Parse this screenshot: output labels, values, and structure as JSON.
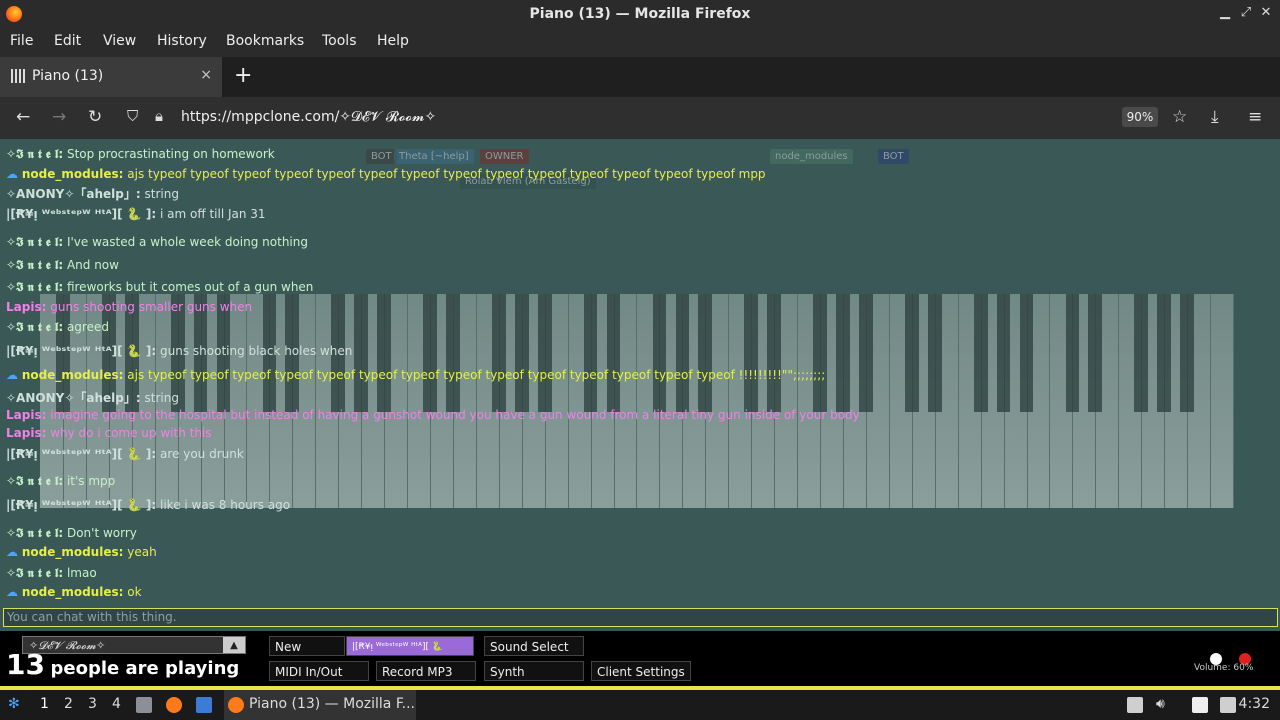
{
  "window": {
    "title": "Piano (13) — Mozilla Firefox"
  },
  "menu": [
    "File",
    "Edit",
    "View",
    "History",
    "Bookmarks",
    "Tools",
    "Help"
  ],
  "tab": {
    "title": "Piano (13)",
    "close": "×",
    "new_tab": "+"
  },
  "nav": {
    "url": "https://mppclone.com/✧𝓓𝓔𝓥 𝓡𝓸𝓸𝓶✧",
    "zoom": "90%"
  },
  "chat": [
    {
      "name": "✧𝕴 𝖓 𝖙 𝖊 𝖑:",
      "text": "Stop procrastinating on homework",
      "name_color": "#c8f0c8",
      "text_color": "#c8f0c8"
    },
    {
      "name": "node_modules:",
      "text": "ajs typeof typeof typeof typeof typeof typeof typeof typeof typeof typeof typeof typeof typeof typeof mpp",
      "name_color": "#e6ee4a",
      "text_color": "#e6ee4a"
    },
    {
      "name": "✧ANONY✧「ahelp」:",
      "text": "string",
      "name_color": "#d0e0dc",
      "text_color": "#d0e0dc"
    },
    {
      "name": "|[Ꞧ¥ᴉ ᵂᵉᵇˢᵗᵉᵖᵂ ᴴᵗᴬ][ 🐍 ]:",
      "text": "i am off till Jan 31",
      "name_color": "#d0e0dc",
      "text_color": "#d0e0dc"
    },
    {
      "name": "✧𝕴 𝖓 𝖙 𝖊 𝖑:",
      "text": "I've wasted a whole week doing nothing",
      "name_color": "#c8f0c8",
      "text_color": "#c8f0c8"
    },
    {
      "name": "✧𝕴 𝖓 𝖙 𝖊 𝖑:",
      "text": "And now",
      "name_color": "#c8f0c8",
      "text_color": "#c8f0c8"
    },
    {
      "name": "✧𝕴 𝖓 𝖙 𝖊 𝖑:",
      "text": "fireworks but it comes out of a gun when",
      "name_color": "#c8f0c8",
      "text_color": "#c8f0c8"
    },
    {
      "name": "Lapis:",
      "text": "guns shooting smaller guns when",
      "name_color": "#f080e8",
      "text_color": "#f080e8"
    },
    {
      "name": "✧𝕴 𝖓 𝖙 𝖊 𝖑:",
      "text": "agreed",
      "name_color": "#c8f0c8",
      "text_color": "#c8f0c8"
    },
    {
      "name": "|[Ꞧ¥ᴉ ᵂᵉᵇˢᵗᵉᵖᵂ ᴴᵗᴬ][ 🐍 ]:",
      "text": "guns shooting black holes when",
      "name_color": "#d0e0dc",
      "text_color": "#d0e0dc"
    },
    {
      "name": "node_modules:",
      "text": "ajs typeof typeof typeof typeof typeof typeof typeof typeof typeof typeof typeof typeof typeof typeof !!!!!!!!!\"\";;;;;;;;",
      "name_color": "#e6ee4a",
      "text_color": "#e6ee4a"
    },
    {
      "name": "✧ANONY✧「ahelp」:",
      "text": "string",
      "name_color": "#d0e0dc",
      "text_color": "#d0e0dc"
    },
    {
      "name": "Lapis:",
      "text": "imagine going to the hospital but instead of having a gunshot wound you have a gun wound from a literal tiny gun inside of your body",
      "name_color": "#f080e8",
      "text_color": "#f080e8"
    },
    {
      "name": "Lapis:",
      "text": "why do i come up with this",
      "name_color": "#f080e8",
      "text_color": "#f080e8"
    },
    {
      "name": "|[Ꞧ¥ᴉ ᵂᵉᵇˢᵗᵉᵖᵂ ᴴᵗᴬ][ 🐍 ]:",
      "text": "are you drunk",
      "name_color": "#d0e0dc",
      "text_color": "#d0e0dc"
    },
    {
      "name": "✧𝕴 𝖓 𝖙 𝖊 𝖑:",
      "text": "it's mpp",
      "name_color": "#c8f0c8",
      "text_color": "#c8f0c8"
    },
    {
      "name": "|[Ꞧ¥ᴉ ᵂᵉᵇˢᵗᵉᵖᵂ ᴴᵗᴬ][ 🐍 ]:",
      "text": "like i was 8 hours ago",
      "name_color": "#d0e0dc",
      "text_color": "#d0e0dc"
    },
    {
      "name": "✧𝕴 𝖓 𝖙 𝖊 𝖑:",
      "text": "Don't worry",
      "name_color": "#c8f0c8",
      "text_color": "#c8f0c8"
    },
    {
      "name": "node_modules:",
      "text": "yeah",
      "name_color": "#e6ee4a",
      "text_color": "#e6ee4a"
    },
    {
      "name": "✧𝕴 𝖓 𝖙 𝖊 𝖑:",
      "text": "lmao",
      "name_color": "#c8f0c8",
      "text_color": "#c8f0c8"
    },
    {
      "name": "node_modules:",
      "text": "ok",
      "name_color": "#e6ee4a",
      "text_color": "#e6ee4a"
    }
  ],
  "chat_input_placeholder": "You can chat with this thing.",
  "badges": [
    "BOT",
    "Theta [~help]",
    "OWNER",
    "node_modules",
    "BOT",
    "Rolab Vlem (Am Gastelg)"
  ],
  "room": {
    "name": "✧𝓓𝓔𝓥 𝓡𝓸𝓸𝓶✧",
    "arrow": "▲"
  },
  "players": {
    "count": "13",
    "label": "people are playing"
  },
  "buttons": {
    "new_room": "New Room...",
    "user_tag": "|[Ꞧ¥ᴉ ᵂᵉᵇˢᵗᵉᵖᵂ ᴴᵗᴬ][ 🐍",
    "sound_select": "Sound Select",
    "midi": "MIDI In/Out",
    "record": "Record MP3",
    "synth": "Synth",
    "client_settings": "Client Settings"
  },
  "volume": "Volume: 60%",
  "taskbar": {
    "workspaces": [
      "1",
      "2",
      "3",
      "4"
    ],
    "window": "Piano (13) — Mozilla F...",
    "clock": "4:32"
  },
  "colors": {
    "accent": "#e9e34a",
    "chat_bg": "#3a5956",
    "status_red": "#e02020"
  }
}
